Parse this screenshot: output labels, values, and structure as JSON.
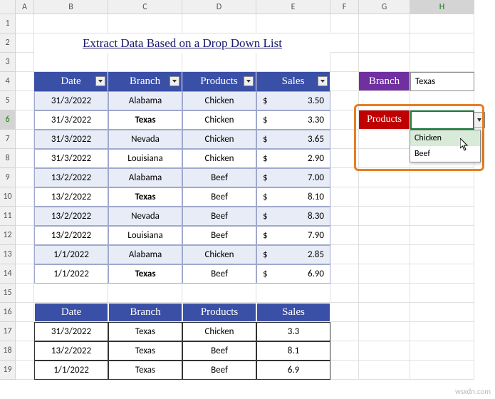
{
  "columns": [
    "",
    "A",
    "B",
    "C",
    "D",
    "E",
    "F",
    "G",
    "H"
  ],
  "rows": [
    "1",
    "2",
    "3",
    "4",
    "5",
    "6",
    "7",
    "8",
    "9",
    "10",
    "11",
    "12",
    "13",
    "14",
    "15",
    "16",
    "17",
    "18",
    "19"
  ],
  "title": "Extract Data Based on a Drop Down List",
  "main_headers": [
    "Date",
    "Branch",
    "Products",
    "Sales"
  ],
  "main_data": [
    {
      "date": "31/3/2022",
      "branch": "Alabama",
      "product": "Chicken",
      "sales": "3.50",
      "bold": false
    },
    {
      "date": "31/3/2022",
      "branch": "Texas",
      "product": "Chicken",
      "sales": "3.30",
      "bold": true
    },
    {
      "date": "31/3/2022",
      "branch": "Nevada",
      "product": "Chicken",
      "sales": "3.65",
      "bold": false
    },
    {
      "date": "31/3/2022",
      "branch": "Louisiana",
      "product": "Chicken",
      "sales": "2.90",
      "bold": false
    },
    {
      "date": "13/2/2022",
      "branch": "Alabama",
      "product": "Beef",
      "sales": "7.00",
      "bold": false
    },
    {
      "date": "13/2/2022",
      "branch": "Texas",
      "product": "Beef",
      "sales": "8.10",
      "bold": true
    },
    {
      "date": "13/2/2022",
      "branch": "Nevada",
      "product": "Beef",
      "sales": "8.30",
      "bold": false
    },
    {
      "date": "13/2/2022",
      "branch": "Louisiana",
      "product": "Beef",
      "sales": "7.90",
      "bold": false
    },
    {
      "date": "1/1/2022",
      "branch": "Alabama",
      "product": "Chicken",
      "sales": "2.85",
      "bold": false
    },
    {
      "date": "1/1/2022",
      "branch": "Texas",
      "product": "Beef",
      "sales": "6.90",
      "bold": true
    }
  ],
  "side_labels": {
    "branch": "Branch",
    "products": "Products"
  },
  "branch_value": "Texas",
  "products_value": "",
  "dropdown_options": [
    "Chicken",
    "Beef"
  ],
  "result_headers": [
    "Date",
    "Branch",
    "Products",
    "Sales"
  ],
  "result_data": [
    {
      "date": "31/3/2022",
      "branch": "Texas",
      "product": "Chicken",
      "sales": "3.3"
    },
    {
      "date": "13/2/2022",
      "branch": "Texas",
      "product": "Beef",
      "sales": "8.1"
    },
    {
      "date": "1/1/2022",
      "branch": "Texas",
      "product": "Beef",
      "sales": "6.9"
    }
  ],
  "watermark": "wsxdn.com",
  "selected_row": "6",
  "selected_col": "H"
}
